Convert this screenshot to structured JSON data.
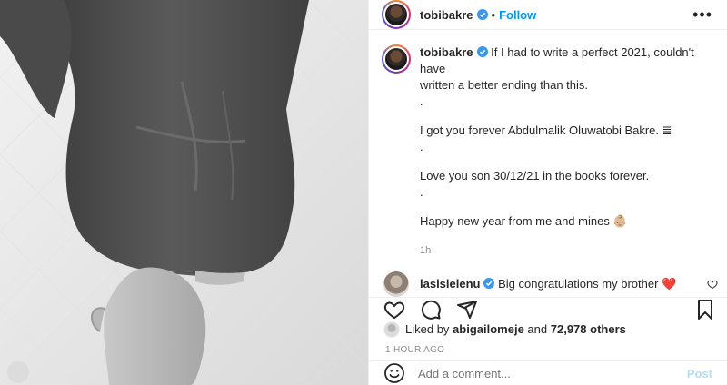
{
  "post": {
    "author": "tobibakre",
    "follow_label": "Follow",
    "more_label": "•••",
    "separator": "•",
    "caption_lines": [
      "If I had to write a perfect 2021, couldn't have",
      "written a better ending than this.",
      ".",
      "I got you forever Abdulmalik Oluwatobi Bakre. ≣",
      ".",
      "Love you son 30/12/21 in the books forever.",
      ".",
      "Happy new year from me and mines 👶🏼"
    ],
    "caption_time": "1h"
  },
  "comment": {
    "user": "lasisielenu",
    "text": "Big congratulations my brother ❤️"
  },
  "likes": {
    "prefix": "Liked by",
    "user": "abigailomeje",
    "joiner": "and",
    "others": "72,978 others"
  },
  "post_age": "1 HOUR AGO",
  "add_comment": {
    "placeholder": "Add a comment...",
    "post_label": "Post"
  },
  "colors": {
    "accent": "#0095f6",
    "verified": "#3897f0",
    "heart_red": "#ed4956"
  },
  "icons": [
    "verified-badge-icon",
    "heart-icon",
    "comment-icon",
    "share-icon",
    "bookmark-icon",
    "emoji-icon",
    "small-heart-icon"
  ]
}
